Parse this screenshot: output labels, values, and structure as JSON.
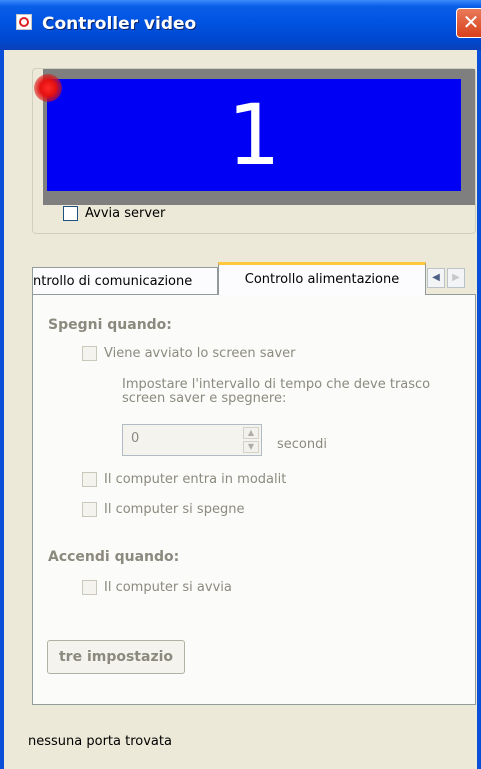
{
  "window": {
    "title": "Controller video",
    "close_glyph": "✕"
  },
  "display": {
    "number": "1",
    "indicator_color": "#e41010",
    "screen_color": "#0000f5"
  },
  "server": {
    "start_label": "Avvia server",
    "checked": false
  },
  "tabs": [
    {
      "label": "ntrollo di comunicazione",
      "active": false
    },
    {
      "label": "Controllo alimentazione",
      "active": true
    }
  ],
  "tab_scroll": {
    "left_icon": "◀",
    "right_icon": "▶"
  },
  "power": {
    "off_heading": "Spegni quando:",
    "screensaver_label": "Viene avviato lo screen saver",
    "interval_desc_line1": "Impostare l'intervallo di tempo che deve trasco",
    "interval_desc_line2": "screen saver e spegnere:",
    "interval_value": "0",
    "interval_unit": "secondi",
    "standby_label": "Il computer entra in modalit",
    "shutdown_label": "Il computer si spegne",
    "on_heading": "Accendi quando:",
    "startup_label": "Il computer si avvia",
    "settings_button": "tre impostazio"
  },
  "status": {
    "text": "nessuna porta trovata"
  }
}
